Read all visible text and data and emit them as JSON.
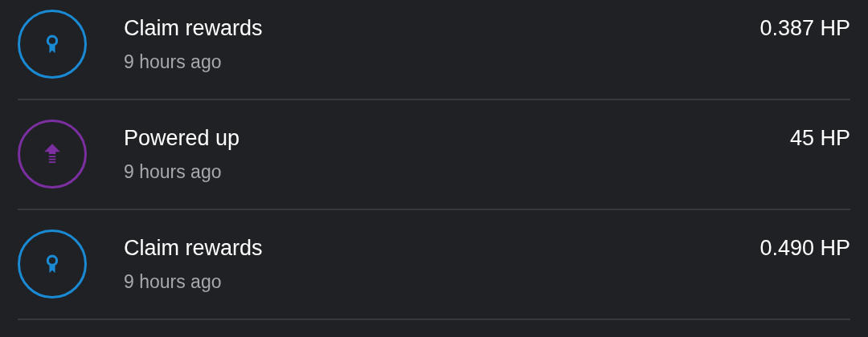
{
  "transactions": [
    {
      "kind": "reward",
      "color": "#1a8ad4",
      "title": "Claim rewards",
      "time": "9 hours ago",
      "amount": "0.387 HP"
    },
    {
      "kind": "power_up",
      "color": "#7b2fa0",
      "title": "Powered up",
      "time": "9 hours ago",
      "amount": "45 HP"
    },
    {
      "kind": "reward",
      "color": "#1a8ad4",
      "title": "Claim rewards",
      "time": "9 hours ago",
      "amount": "0.490 HP"
    }
  ]
}
